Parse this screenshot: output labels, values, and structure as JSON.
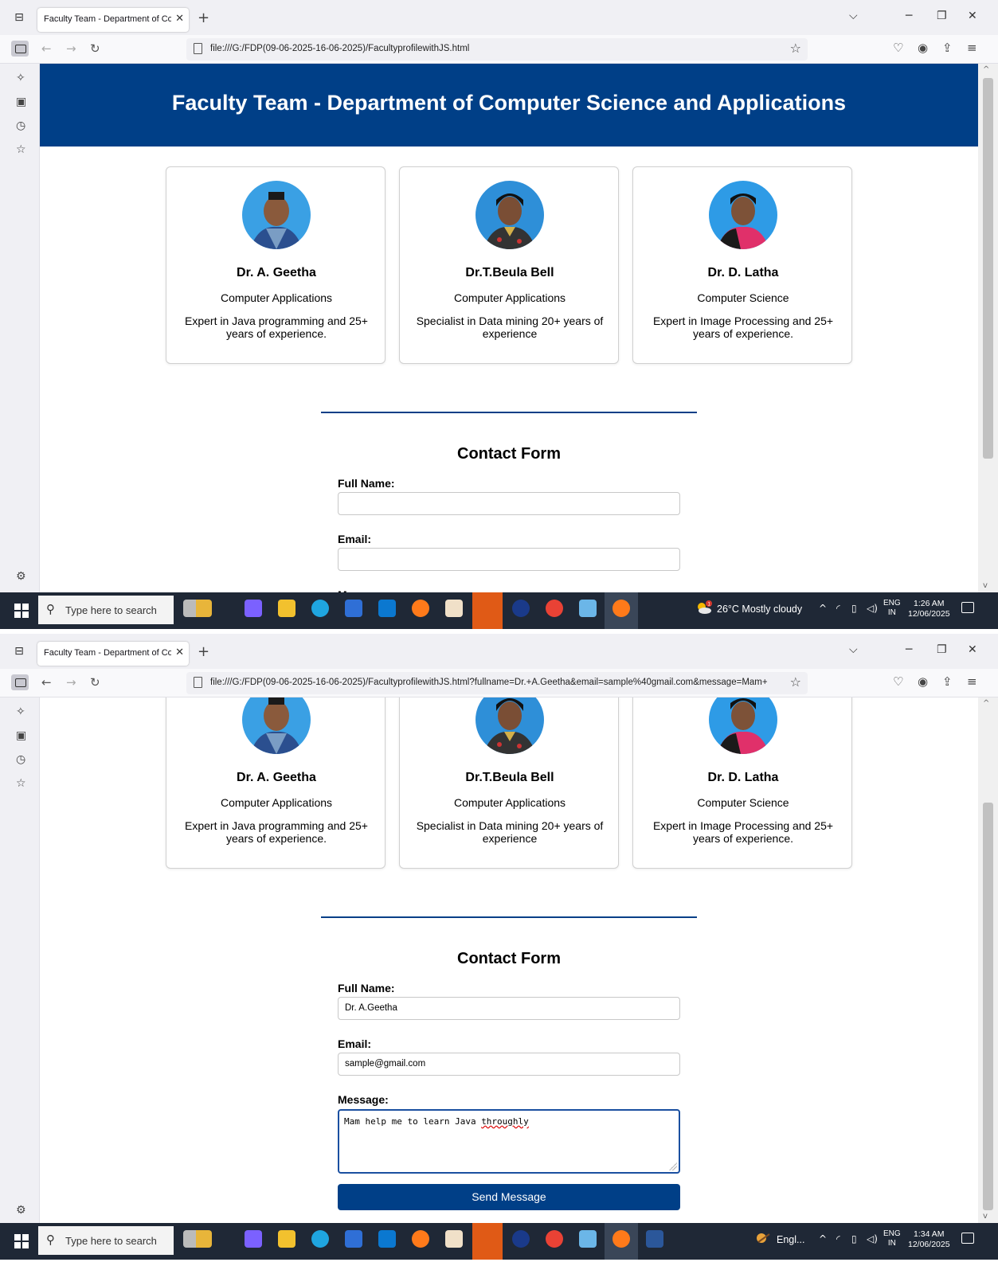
{
  "browser": {
    "tab_title": "Faculty Team - Department of Comp",
    "tab_close": "✕",
    "new_tab": "+",
    "bookmark_star": "☆",
    "url_before_submit": "file:///G:/FDP(09-06-2025-16-06-2025)/FacultyprofilewithJS.html",
    "url_after_submit": "file:///G:/FDP(09-06-2025-16-06-2025)/FacultyprofilewithJS.html?fullname=Dr.+A.Geetha&email=sample%40gmail.com&message=Mam+"
  },
  "page": {
    "header_title": "Faculty Team - Department of Computer Science and Applications",
    "faculty": [
      {
        "name": "Dr. A. Geetha",
        "department": "Computer Applications",
        "description": "Expert in Java programming and 25+ years of experience."
      },
      {
        "name": "Dr.T.Beula Bell",
        "department": "Computer Applications",
        "description": "Specialist in Data mining 20+ years of experience"
      },
      {
        "name": "Dr. D. Latha",
        "department": "Computer Science",
        "description": "Expert in Image Processing and 25+ years of experience."
      }
    ],
    "contact_form": {
      "title": "Contact Form",
      "fullname_label": "Full Name:",
      "email_label": "Email:",
      "message_label": "Message:",
      "fullname_value": "Dr. A.Geetha",
      "email_value": "sample@gmail.com",
      "message_value_plain": "Mam help me to learn Java ",
      "message_value_misspelled": "throughly",
      "submit_label": "Send Message"
    }
  },
  "taskbar": {
    "search_placeholder": "Type here to search",
    "weather_1": "26°C  Mostly cloudy",
    "weather_2": "Engl...",
    "lang_top": "ENG",
    "lang_bottom": "IN",
    "time_1": "1:26 AM",
    "date_1": "12/06/2025",
    "time_2": "1:34 AM",
    "date_2": "12/06/2025",
    "weather_badge": "1"
  },
  "colors": {
    "header_blue": "#003f87",
    "button_blue": "#003f87",
    "taskbar": "#1f2836"
  },
  "icons": [
    "tab-list-icon",
    "back-arrow-icon",
    "forward-arrow-icon",
    "reload-icon",
    "page-icon",
    "bookmark-star-icon",
    "pocket-icon",
    "account-icon",
    "extensions-icon",
    "menu-icon",
    "ai-chat-icon",
    "synced-tabs-icon",
    "history-icon",
    "bookmarks-icon",
    "settings-icon",
    "windows-start-icon",
    "search-icon",
    "weather-icon",
    "notification-icon"
  ]
}
